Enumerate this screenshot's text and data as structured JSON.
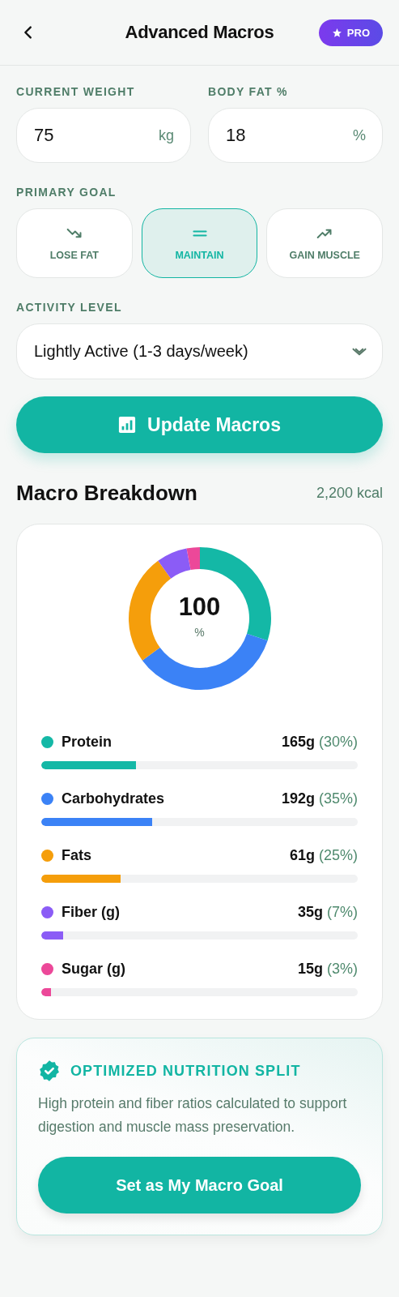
{
  "header": {
    "title": "Advanced Macros",
    "badge": "PRO"
  },
  "fields": [
    {
      "label": "CURRENT WEIGHT",
      "value": "75",
      "unit": "kg"
    },
    {
      "label": "BODY FAT %",
      "value": "18",
      "unit": "%"
    }
  ],
  "goal": {
    "label": "PRIMARY GOAL",
    "options": [
      {
        "label": "LOSE FAT",
        "kind": "down",
        "selected": false
      },
      {
        "label": "MAINTAIN",
        "kind": "flat",
        "selected": true
      },
      {
        "label": "GAIN MUSCLE",
        "kind": "up",
        "selected": false
      }
    ]
  },
  "activity": {
    "label": "ACTIVITY LEVEL",
    "value": "Lightly Active (1-3 days/week)"
  },
  "update_button": "Update Macros",
  "breakdown": {
    "title": "Macro Breakdown",
    "total": "2,200 kcal",
    "chart_data": {
      "type": "donut",
      "categories": [
        "Protein",
        "Carbohydrates",
        "Fats",
        "Fiber (g)",
        "Sugar (g)"
      ],
      "values": [
        30,
        35,
        25,
        7,
        3
      ]
    },
    "center_value": "100",
    "center_unit": "%",
    "macros": [
      {
        "grams": "165g",
        "percent": "(30%)",
        "level": 0.3,
        "color": "#14b8a6"
      },
      {
        "grams": "192g",
        "percent": "(35%)",
        "level": 0.35,
        "color": "#3b82f6"
      },
      {
        "grams": "61g",
        "percent": "(25%)",
        "level": 0.25,
        "color": "#f59e0b"
      },
      {
        "grams": "35g",
        "percent": "(7%)",
        "level": 0.07,
        "color": "#8b5cf6"
      },
      {
        "grams": "15g",
        "percent": "(3%)",
        "level": 0.03,
        "color": "#ec4899"
      }
    ]
  },
  "insight": {
    "title": "OPTIMIZED NUTRITION SPLIT",
    "text": "High protein and fiber ratios calculated to support digestion and muscle mass preservation.",
    "button": "Set as My Macro Goal"
  }
}
